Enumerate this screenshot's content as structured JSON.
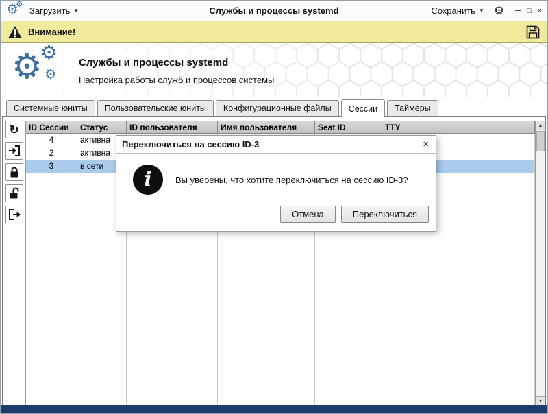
{
  "titlebar": {
    "load_label": "Загрузить",
    "title": "Службы и процессы systemd",
    "save_label": "Сохранить",
    "caret_glyph": "▼",
    "minimize_glyph": "─",
    "maximize_glyph": "□",
    "close_glyph": "×"
  },
  "warning_bar": {
    "label": "Внимание!"
  },
  "hero": {
    "title": "Службы и процессы systemd",
    "subtitle": "Настройка работы служб и процессов системы"
  },
  "tabs": [
    {
      "label": "Системные юниты"
    },
    {
      "label": "Пользовательские юниты"
    },
    {
      "label": "Конфигурационные файлы"
    },
    {
      "label": "Сессии"
    },
    {
      "label": "Таймеры"
    }
  ],
  "active_tab": "Сессии",
  "toolbar": {
    "refresh_glyph": "↻",
    "icons": [
      "refresh",
      "switch-to-session",
      "lock-session",
      "unlock-session",
      "terminate-session"
    ]
  },
  "session_table": {
    "columns": [
      "ID Сессии",
      "Статус",
      "ID пользователя",
      "Имя пользователя",
      "Seat ID",
      "TTY"
    ],
    "rows": [
      {
        "session_id": "4",
        "status": "активна",
        "selected": false
      },
      {
        "session_id": "2",
        "status": "активна",
        "selected": false
      },
      {
        "session_id": "3",
        "status": "в сети",
        "selected": true
      }
    ]
  },
  "scrollbar": {
    "up_glyph": "▲",
    "down_glyph": "▼"
  },
  "dialog": {
    "title": "Переключиться на сессию ID-3",
    "close_glyph": "×",
    "info_glyph": "i",
    "message": "Вы уверены, что хотите переключиться на сессию ID-3?",
    "buttons": [
      {
        "label": "Отмена"
      },
      {
        "label": "Переключиться"
      }
    ]
  },
  "colors": {
    "accent_blue": "#3c6e9e",
    "warning_bg": "#f0ea9d",
    "selected_row": "#a9cbec",
    "bottom_frame": "#1d3c6e"
  }
}
